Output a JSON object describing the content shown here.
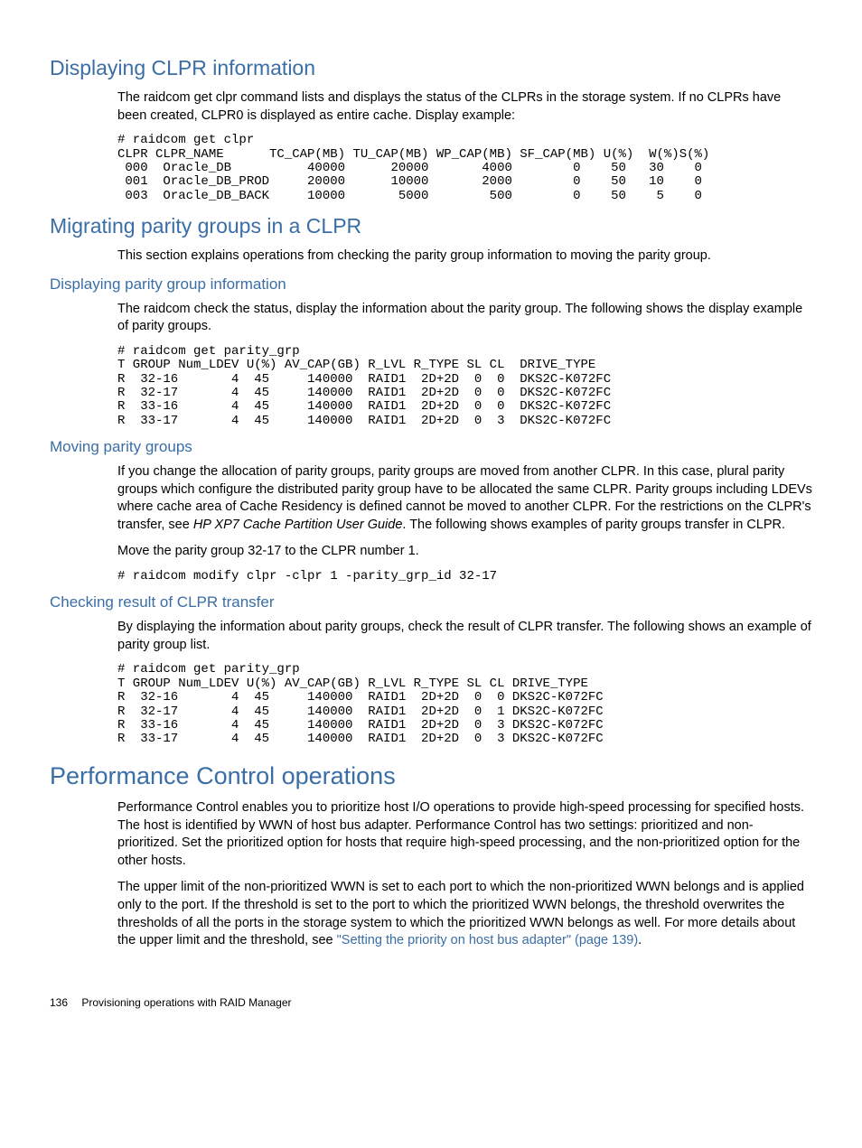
{
  "sections": {
    "displaying_clpr": {
      "title": "Displaying CLPR information",
      "para1": "The raidcom get clpr command lists and displays the status of the CLPRs in the storage system. If no CLPRs have been created, CLPR0 is displayed as entire cache. Display example:",
      "code": "# raidcom get clpr\nCLPR CLPR_NAME      TC_CAP(MB) TU_CAP(MB) WP_CAP(MB) SF_CAP(MB) U(%)  W(%)S(%)\n 000  Oracle_DB          40000      20000       4000        0    50   30    0\n 001  Oracle_DB_PROD     20000      10000       2000        0    50   10    0\n 003  Oracle_DB_BACK     10000       5000        500        0    50    5    0"
    },
    "migrating": {
      "title": "Migrating parity groups in a CLPR",
      "para1": "This section explains operations from checking the parity group information to moving the parity group."
    },
    "display_parity": {
      "title": "Displaying parity group information",
      "para1": "The raidcom check the status, display the information about the parity group. The following shows the display example of parity groups.",
      "code": "# raidcom get parity_grp\nT GROUP Num_LDEV U(%) AV_CAP(GB) R_LVL R_TYPE SL CL  DRIVE_TYPE\nR  32-16       4  45     140000  RAID1  2D+2D  0  0  DKS2C-K072FC\nR  32-17       4  45     140000  RAID1  2D+2D  0  0  DKS2C-K072FC\nR  33-16       4  45     140000  RAID1  2D+2D  0  0  DKS2C-K072FC\nR  33-17       4  45     140000  RAID1  2D+2D  0  3  DKS2C-K072FC"
    },
    "moving_parity": {
      "title": "Moving parity groups",
      "para1_prefix": "If you change the allocation of parity groups, parity groups are moved from another CLPR. In this case, plural parity groups which configure the distributed parity group have to be allocated the same CLPR. Parity groups including LDEVs where cache area of Cache Residency is defined cannot be moved to another CLPR. For the restrictions on the CLPR's transfer, see ",
      "para1_italic": "HP XP7 Cache Partition User Guide",
      "para1_suffix": ". The following shows examples of parity groups transfer in CLPR.",
      "para2": "Move the parity group 32-17 to the CLPR number 1.",
      "code": "# raidcom modify clpr -clpr 1 -parity_grp_id 32-17"
    },
    "checking_result": {
      "title": "Checking result of CLPR transfer",
      "para1": "By displaying the information about parity groups, check the result of CLPR transfer. The following shows an example of parity group list.",
      "code": "# raidcom get parity_grp\nT GROUP Num_LDEV U(%) AV_CAP(GB) R_LVL R_TYPE SL CL DRIVE_TYPE\nR  32-16       4  45     140000  RAID1  2D+2D  0  0 DKS2C-K072FC\nR  32-17       4  45     140000  RAID1  2D+2D  0  1 DKS2C-K072FC\nR  33-16       4  45     140000  RAID1  2D+2D  0  3 DKS2C-K072FC\nR  33-17       4  45     140000  RAID1  2D+2D  0  3 DKS2C-K072FC"
    },
    "performance": {
      "title": "Performance Control operations",
      "para1": "Performance Control enables you to prioritize host I/O operations to provide high-speed processing for specified hosts. The host is identified by WWN of host bus adapter. Performance Control has two settings: prioritized and non-prioritized. Set the prioritized option for hosts that require high-speed processing, and the non-prioritized option for the other hosts.",
      "para2_prefix": "The upper limit of the non-prioritized WWN is set to each port to which the non-prioritized WWN belongs and is applied only to the port. If the threshold is set to the port to which the prioritized WWN belongs, the threshold overwrites the thresholds of all the ports in the storage system to which the prioritized WWN belongs as well. For more details about the upper limit and the threshold, see ",
      "para2_link": "\"Setting the priority on host bus adapter\" (page 139)",
      "para2_suffix": "."
    }
  },
  "footer": {
    "page_number": "136",
    "chapter": "Provisioning operations with RAID Manager"
  }
}
